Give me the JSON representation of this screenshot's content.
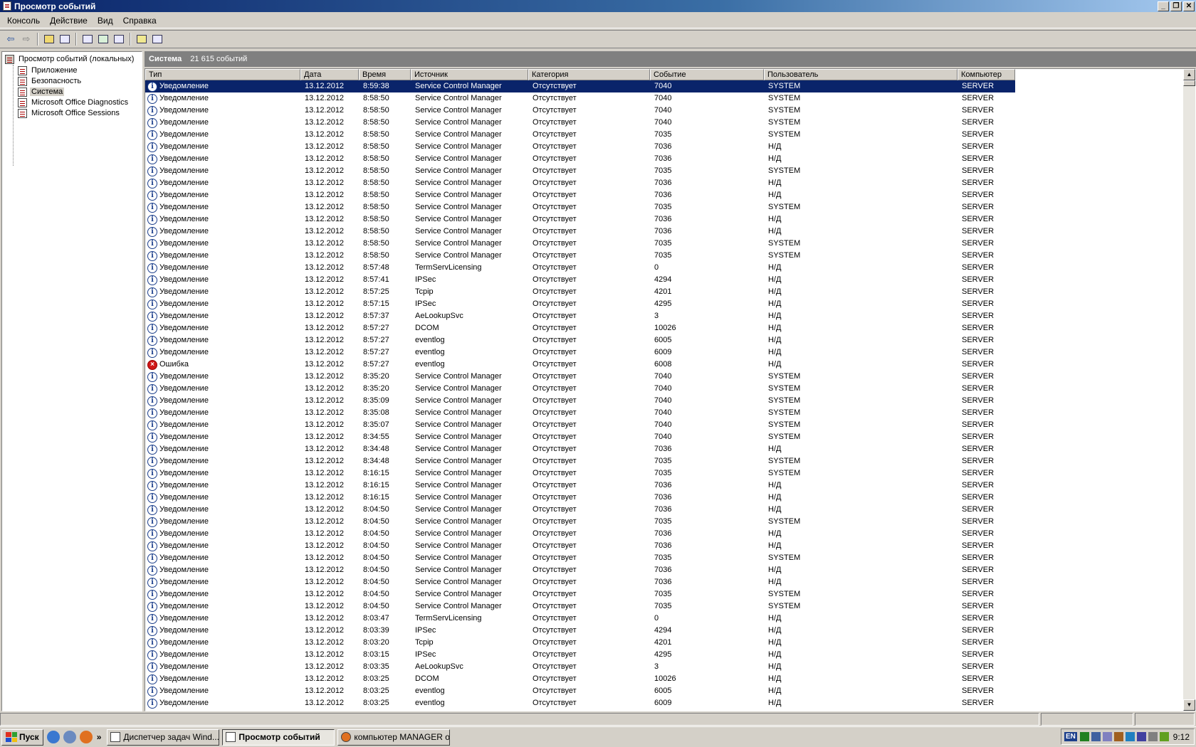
{
  "window": {
    "title": "Просмотр событий"
  },
  "menu": [
    "Консоль",
    "Действие",
    "Вид",
    "Справка"
  ],
  "tree": {
    "root": "Просмотр событий (локальных)",
    "items": [
      "Приложение",
      "Безопасность",
      "Система",
      "Microsoft Office Diagnostics",
      "Microsoft Office Sessions"
    ],
    "selected_index": 2
  },
  "pane": {
    "title": "Система",
    "count": "21 615 событий"
  },
  "columns": [
    "Тип",
    "Дата",
    "Время",
    "Источник",
    "Категория",
    "Событие",
    "Пользователь",
    "Компьютер"
  ],
  "events": [
    [
      "Уведомление",
      "13.12.2012",
      "8:59:38",
      "Service Control Manager",
      "Отсутствует",
      "7040",
      "SYSTEM",
      "SERVER"
    ],
    [
      "Уведомление",
      "13.12.2012",
      "8:58:50",
      "Service Control Manager",
      "Отсутствует",
      "7040",
      "SYSTEM",
      "SERVER"
    ],
    [
      "Уведомление",
      "13.12.2012",
      "8:58:50",
      "Service Control Manager",
      "Отсутствует",
      "7040",
      "SYSTEM",
      "SERVER"
    ],
    [
      "Уведомление",
      "13.12.2012",
      "8:58:50",
      "Service Control Manager",
      "Отсутствует",
      "7040",
      "SYSTEM",
      "SERVER"
    ],
    [
      "Уведомление",
      "13.12.2012",
      "8:58:50",
      "Service Control Manager",
      "Отсутствует",
      "7035",
      "SYSTEM",
      "SERVER"
    ],
    [
      "Уведомление",
      "13.12.2012",
      "8:58:50",
      "Service Control Manager",
      "Отсутствует",
      "7036",
      "Н/Д",
      "SERVER"
    ],
    [
      "Уведомление",
      "13.12.2012",
      "8:58:50",
      "Service Control Manager",
      "Отсутствует",
      "7036",
      "Н/Д",
      "SERVER"
    ],
    [
      "Уведомление",
      "13.12.2012",
      "8:58:50",
      "Service Control Manager",
      "Отсутствует",
      "7035",
      "SYSTEM",
      "SERVER"
    ],
    [
      "Уведомление",
      "13.12.2012",
      "8:58:50",
      "Service Control Manager",
      "Отсутствует",
      "7036",
      "Н/Д",
      "SERVER"
    ],
    [
      "Уведомление",
      "13.12.2012",
      "8:58:50",
      "Service Control Manager",
      "Отсутствует",
      "7036",
      "Н/Д",
      "SERVER"
    ],
    [
      "Уведомление",
      "13.12.2012",
      "8:58:50",
      "Service Control Manager",
      "Отсутствует",
      "7035",
      "SYSTEM",
      "SERVER"
    ],
    [
      "Уведомление",
      "13.12.2012",
      "8:58:50",
      "Service Control Manager",
      "Отсутствует",
      "7036",
      "Н/Д",
      "SERVER"
    ],
    [
      "Уведомление",
      "13.12.2012",
      "8:58:50",
      "Service Control Manager",
      "Отсутствует",
      "7036",
      "Н/Д",
      "SERVER"
    ],
    [
      "Уведомление",
      "13.12.2012",
      "8:58:50",
      "Service Control Manager",
      "Отсутствует",
      "7035",
      "SYSTEM",
      "SERVER"
    ],
    [
      "Уведомление",
      "13.12.2012",
      "8:58:50",
      "Service Control Manager",
      "Отсутствует",
      "7035",
      "SYSTEM",
      "SERVER"
    ],
    [
      "Уведомление",
      "13.12.2012",
      "8:57:48",
      "TermServLicensing",
      "Отсутствует",
      "0",
      "Н/Д",
      "SERVER"
    ],
    [
      "Уведомление",
      "13.12.2012",
      "8:57:41",
      "IPSec",
      "Отсутствует",
      "4294",
      "Н/Д",
      "SERVER"
    ],
    [
      "Уведомление",
      "13.12.2012",
      "8:57:25",
      "Tcpip",
      "Отсутствует",
      "4201",
      "Н/Д",
      "SERVER"
    ],
    [
      "Уведомление",
      "13.12.2012",
      "8:57:15",
      "IPSec",
      "Отсутствует",
      "4295",
      "Н/Д",
      "SERVER"
    ],
    [
      "Уведомление",
      "13.12.2012",
      "8:57:37",
      "AeLookupSvc",
      "Отсутствует",
      "3",
      "Н/Д",
      "SERVER"
    ],
    [
      "Уведомление",
      "13.12.2012",
      "8:57:27",
      "DCOM",
      "Отсутствует",
      "10026",
      "Н/Д",
      "SERVER"
    ],
    [
      "Уведомление",
      "13.12.2012",
      "8:57:27",
      "eventlog",
      "Отсутствует",
      "6005",
      "Н/Д",
      "SERVER"
    ],
    [
      "Уведомление",
      "13.12.2012",
      "8:57:27",
      "eventlog",
      "Отсутствует",
      "6009",
      "Н/Д",
      "SERVER"
    ],
    [
      "Ошибка",
      "13.12.2012",
      "8:57:27",
      "eventlog",
      "Отсутствует",
      "6008",
      "Н/Д",
      "SERVER"
    ],
    [
      "Уведомление",
      "13.12.2012",
      "8:35:20",
      "Service Control Manager",
      "Отсутствует",
      "7040",
      "SYSTEM",
      "SERVER"
    ],
    [
      "Уведомление",
      "13.12.2012",
      "8:35:20",
      "Service Control Manager",
      "Отсутствует",
      "7040",
      "SYSTEM",
      "SERVER"
    ],
    [
      "Уведомление",
      "13.12.2012",
      "8:35:09",
      "Service Control Manager",
      "Отсутствует",
      "7040",
      "SYSTEM",
      "SERVER"
    ],
    [
      "Уведомление",
      "13.12.2012",
      "8:35:08",
      "Service Control Manager",
      "Отсутствует",
      "7040",
      "SYSTEM",
      "SERVER"
    ],
    [
      "Уведомление",
      "13.12.2012",
      "8:35:07",
      "Service Control Manager",
      "Отсутствует",
      "7040",
      "SYSTEM",
      "SERVER"
    ],
    [
      "Уведомление",
      "13.12.2012",
      "8:34:55",
      "Service Control Manager",
      "Отсутствует",
      "7040",
      "SYSTEM",
      "SERVER"
    ],
    [
      "Уведомление",
      "13.12.2012",
      "8:34:48",
      "Service Control Manager",
      "Отсутствует",
      "7036",
      "Н/Д",
      "SERVER"
    ],
    [
      "Уведомление",
      "13.12.2012",
      "8:34:48",
      "Service Control Manager",
      "Отсутствует",
      "7035",
      "SYSTEM",
      "SERVER"
    ],
    [
      "Уведомление",
      "13.12.2012",
      "8:16:15",
      "Service Control Manager",
      "Отсутствует",
      "7035",
      "SYSTEM",
      "SERVER"
    ],
    [
      "Уведомление",
      "13.12.2012",
      "8:16:15",
      "Service Control Manager",
      "Отсутствует",
      "7036",
      "Н/Д",
      "SERVER"
    ],
    [
      "Уведомление",
      "13.12.2012",
      "8:16:15",
      "Service Control Manager",
      "Отсутствует",
      "7036",
      "Н/Д",
      "SERVER"
    ],
    [
      "Уведомление",
      "13.12.2012",
      "8:04:50",
      "Service Control Manager",
      "Отсутствует",
      "7036",
      "Н/Д",
      "SERVER"
    ],
    [
      "Уведомление",
      "13.12.2012",
      "8:04:50",
      "Service Control Manager",
      "Отсутствует",
      "7035",
      "SYSTEM",
      "SERVER"
    ],
    [
      "Уведомление",
      "13.12.2012",
      "8:04:50",
      "Service Control Manager",
      "Отсутствует",
      "7036",
      "Н/Д",
      "SERVER"
    ],
    [
      "Уведомление",
      "13.12.2012",
      "8:04:50",
      "Service Control Manager",
      "Отсутствует",
      "7036",
      "Н/Д",
      "SERVER"
    ],
    [
      "Уведомление",
      "13.12.2012",
      "8:04:50",
      "Service Control Manager",
      "Отсутствует",
      "7035",
      "SYSTEM",
      "SERVER"
    ],
    [
      "Уведомление",
      "13.12.2012",
      "8:04:50",
      "Service Control Manager",
      "Отсутствует",
      "7036",
      "Н/Д",
      "SERVER"
    ],
    [
      "Уведомление",
      "13.12.2012",
      "8:04:50",
      "Service Control Manager",
      "Отсутствует",
      "7036",
      "Н/Д",
      "SERVER"
    ],
    [
      "Уведомление",
      "13.12.2012",
      "8:04:50",
      "Service Control Manager",
      "Отсутствует",
      "7035",
      "SYSTEM",
      "SERVER"
    ],
    [
      "Уведомление",
      "13.12.2012",
      "8:04:50",
      "Service Control Manager",
      "Отсутствует",
      "7035",
      "SYSTEM",
      "SERVER"
    ],
    [
      "Уведомление",
      "13.12.2012",
      "8:03:47",
      "TermServLicensing",
      "Отсутствует",
      "0",
      "Н/Д",
      "SERVER"
    ],
    [
      "Уведомление",
      "13.12.2012",
      "8:03:39",
      "IPSec",
      "Отсутствует",
      "4294",
      "Н/Д",
      "SERVER"
    ],
    [
      "Уведомление",
      "13.12.2012",
      "8:03:20",
      "Tcpip",
      "Отсутствует",
      "4201",
      "Н/Д",
      "SERVER"
    ],
    [
      "Уведомление",
      "13.12.2012",
      "8:03:15",
      "IPSec",
      "Отсутствует",
      "4295",
      "Н/Д",
      "SERVER"
    ],
    [
      "Уведомление",
      "13.12.2012",
      "8:03:35",
      "AeLookupSvc",
      "Отсутствует",
      "3",
      "Н/Д",
      "SERVER"
    ],
    [
      "Уведомление",
      "13.12.2012",
      "8:03:25",
      "DCOM",
      "Отсутствует",
      "10026",
      "Н/Д",
      "SERVER"
    ],
    [
      "Уведомление",
      "13.12.2012",
      "8:03:25",
      "eventlog",
      "Отсутствует",
      "6005",
      "Н/Д",
      "SERVER"
    ],
    [
      "Уведомление",
      "13.12.2012",
      "8:03:25",
      "eventlog",
      "Отсутствует",
      "6009",
      "Н/Д",
      "SERVER"
    ]
  ],
  "selected_event_index": 0,
  "icons": {
    "info": "i",
    "error": "×"
  },
  "taskbar": {
    "start": "Пуск",
    "chevron": "»",
    "tasks": [
      "Диспетчер задач Wind...",
      "Просмотр событий",
      "компьютер MANAGER о..."
    ],
    "active_index": 1,
    "tray_lang": "EN",
    "clock": "9:12"
  },
  "colors": {
    "selection": "#0a246a",
    "info_icon": "#1c3f8c",
    "error_icon": "#d01818",
    "pane_header": "#808080"
  }
}
